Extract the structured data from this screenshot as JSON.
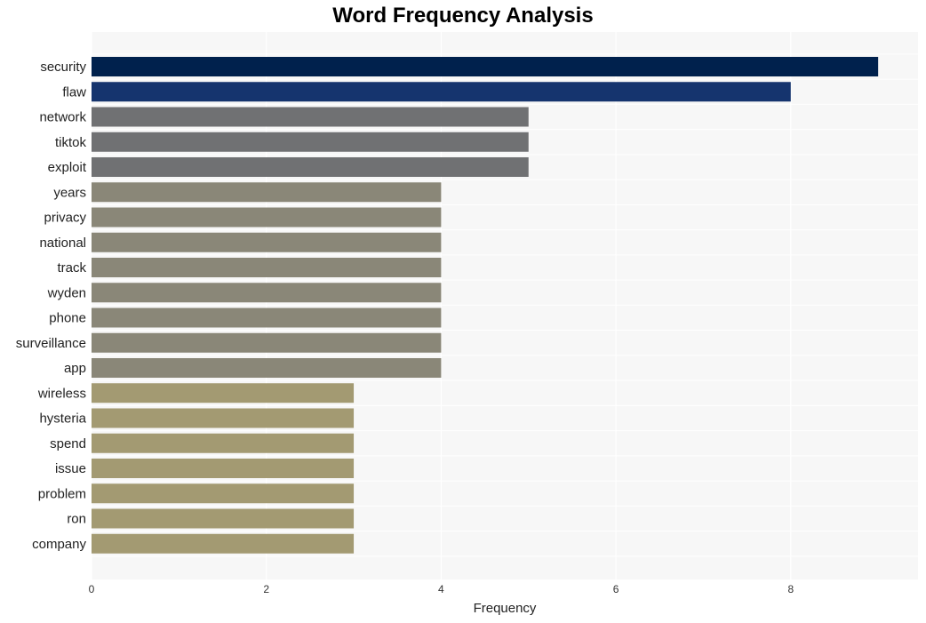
{
  "chart_data": {
    "type": "bar",
    "orientation": "horizontal",
    "title": "Word Frequency Analysis",
    "xlabel": "Frequency",
    "ylabel": "",
    "xlim": [
      0,
      9.45
    ],
    "xticks": [
      0,
      2,
      4,
      6,
      8
    ],
    "grid": true,
    "categories": [
      "security",
      "flaw",
      "network",
      "tiktok",
      "exploit",
      "years",
      "privacy",
      "national",
      "track",
      "wyden",
      "phone",
      "surveillance",
      "app",
      "wireless",
      "hysteria",
      "spend",
      "issue",
      "problem",
      "ron",
      "company"
    ],
    "values": [
      9,
      8,
      5,
      5,
      5,
      4,
      4,
      4,
      4,
      4,
      4,
      4,
      4,
      3,
      3,
      3,
      3,
      3,
      3,
      3
    ],
    "colors": [
      "#00214d",
      "#15346e",
      "#707173",
      "#707173",
      "#707173",
      "#8a8778",
      "#8a8778",
      "#8a8778",
      "#8a8778",
      "#8a8778",
      "#8a8778",
      "#8a8778",
      "#8a8778",
      "#a39a72",
      "#a39a72",
      "#a39a72",
      "#a39a72",
      "#a39a72",
      "#a39a72",
      "#a39a72"
    ],
    "background_color": "#f7f7f7",
    "grid_color": "#ffffff"
  }
}
